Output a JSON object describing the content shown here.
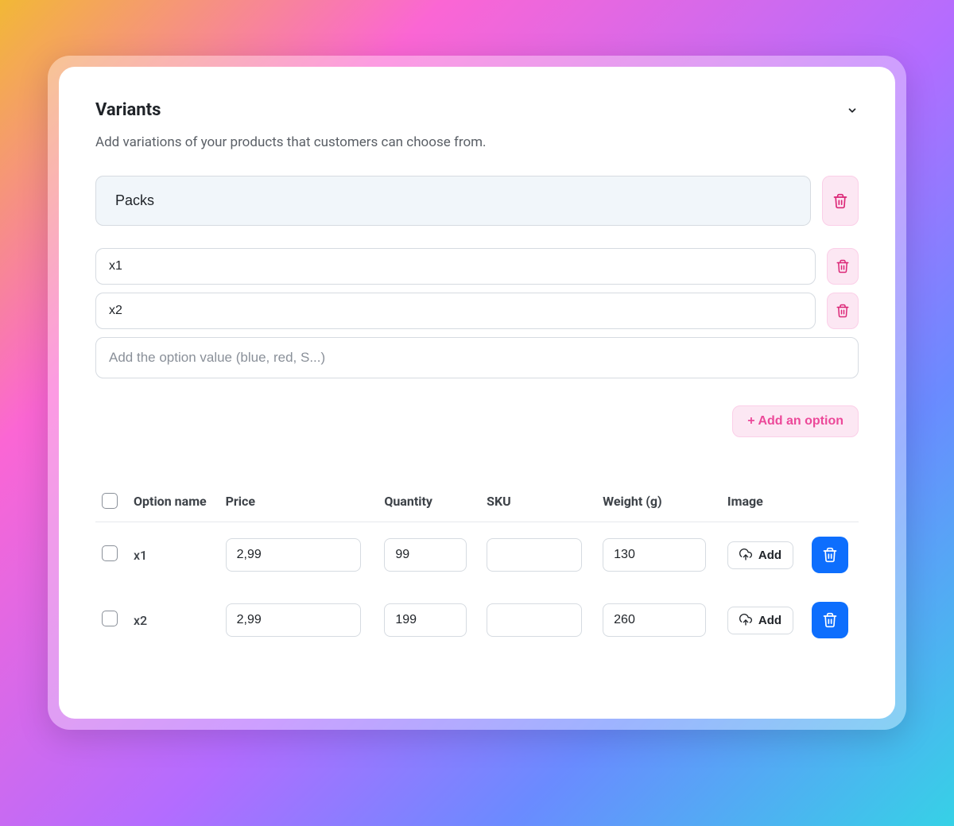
{
  "header": {
    "title": "Variants",
    "subtitle": "Add variations of your products that customers can choose from."
  },
  "option": {
    "name": "Packs",
    "values": [
      "x1",
      "x2"
    ],
    "new_value_placeholder": "Add the option value (blue, red, S...)"
  },
  "buttons": {
    "add_option": "+ Add an option",
    "image_add": "Add"
  },
  "table": {
    "columns": {
      "option_name": "Option name",
      "price": "Price",
      "quantity": "Quantity",
      "sku": "SKU",
      "weight": "Weight (g)",
      "image": "Image"
    },
    "rows": [
      {
        "name": "x1",
        "price": "2,99",
        "quantity": "99",
        "sku": "",
        "weight": "130"
      },
      {
        "name": "x2",
        "price": "2,99",
        "quantity": "199",
        "sku": "",
        "weight": "260"
      }
    ]
  }
}
